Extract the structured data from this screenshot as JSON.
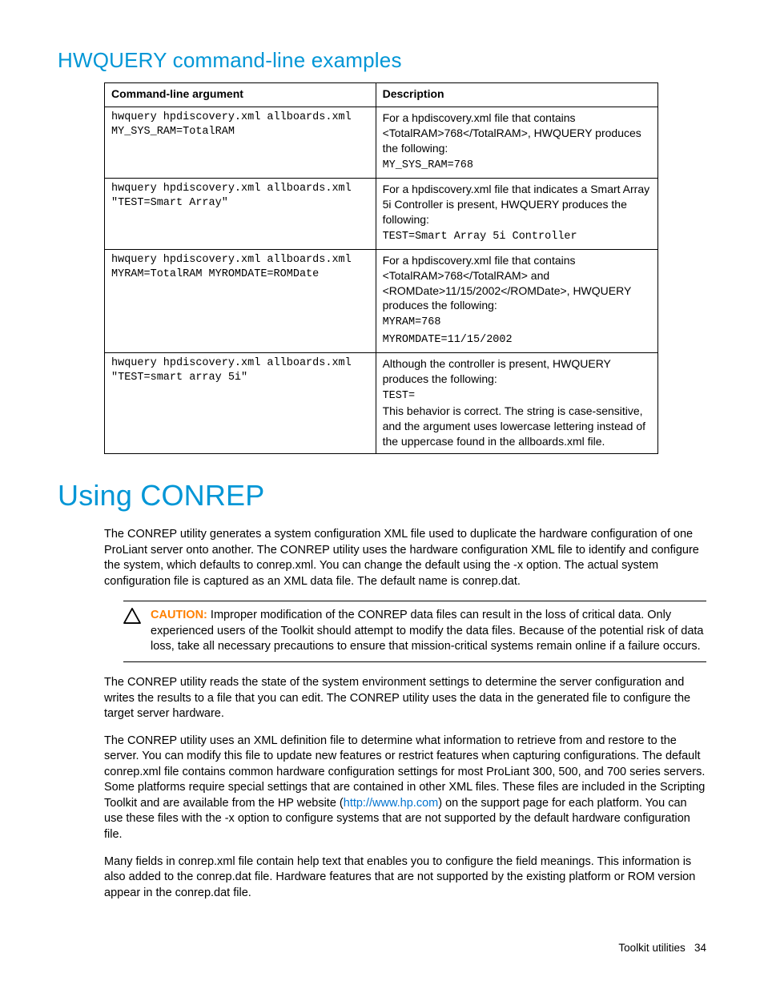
{
  "section1": {
    "title": "HWQUERY command-line examples",
    "table": {
      "headers": [
        "Command-line argument",
        "Description"
      ],
      "rows": [
        {
          "arg": "hwquery hpdiscovery.xml allboards.xml\nMY_SYS_RAM=TotalRAM",
          "desc_pre": "For a hpdiscovery.xml file that contains <TotalRAM>768</TotalRAM>, HWQUERY produces the following:",
          "desc_mono": "MY_SYS_RAM=768",
          "desc_post": ""
        },
        {
          "arg": "hwquery hpdiscovery.xml allboards.xml\n\"TEST=Smart Array\"",
          "desc_pre": "For a hpdiscovery.xml file that indicates a Smart Array 5i Controller is present, HWQUERY produces the following:",
          "desc_mono": "TEST=Smart Array 5i Controller",
          "desc_post": ""
        },
        {
          "arg": "hwquery hpdiscovery.xml allboards.xml\nMYRAM=TotalRAM MYROMDATE=ROMDate",
          "desc_pre": "For a hpdiscovery.xml file that contains <TotalRAM>768</TotalRAM> and <ROMDate>11/15/2002</ROMDate>, HWQUERY produces the following:",
          "desc_mono": "MYRAM=768\nMYROMDATE=11/15/2002",
          "desc_post": ""
        },
        {
          "arg": "hwquery hpdiscovery.xml allboards.xml\n\"TEST=smart array 5i\"",
          "desc_pre": "Although the controller is present, HWQUERY produces the following:",
          "desc_mono": "TEST=",
          "desc_post": "This behavior is correct. The string is case-sensitive, and the argument uses lowercase lettering instead of the uppercase found in the allboards.xml file."
        }
      ]
    }
  },
  "section2": {
    "title": "Using CONREP",
    "para1": "The CONREP utility generates a system configuration XML file used to duplicate the hardware configuration of one ProLiant server onto another. The CONREP utility uses the hardware configuration XML file to identify and configure the system, which defaults to conrep.xml. You can change the default using the -x option. The actual system configuration file is captured as an XML data file. The default name is conrep.dat.",
    "caution_label": "CAUTION:",
    "caution_text": "Improper modification of the CONREP data files can result in the loss of critical data. Only experienced users of the Toolkit should attempt to modify the data files. Because of the potential risk of data loss, take all necessary precautions to ensure that mission-critical systems remain online if a failure occurs.",
    "para2": "The CONREP utility reads the state of the system environment settings to determine the server configuration and writes the results to a file that you can edit. The CONREP utility uses the data in the generated file to configure the target server hardware.",
    "para3_a": "The CONREP utility uses an XML definition file to determine what information to retrieve from and restore to the server. You can modify this file to update new features or restrict features when capturing configurations. The default conrep.xml file contains common hardware configuration settings for most ProLiant 300, 500, and 700 series servers. Some platforms require special settings that are contained in other XML files. These files are included in the Scripting Toolkit and are available from the HP website (",
    "para3_link": "http://www.hp.com",
    "para3_b": ") on the support page for each platform. You can use these files with the -x option to configure systems that are not supported by the default hardware configuration file.",
    "para4": "Many fields in conrep.xml file contain help text that enables you to configure the field meanings. This information is also added to the conrep.dat file. Hardware features that are not supported by the existing platform or ROM version appear in the conrep.dat file."
  },
  "footer": {
    "text": "Toolkit utilities",
    "page": "34"
  }
}
